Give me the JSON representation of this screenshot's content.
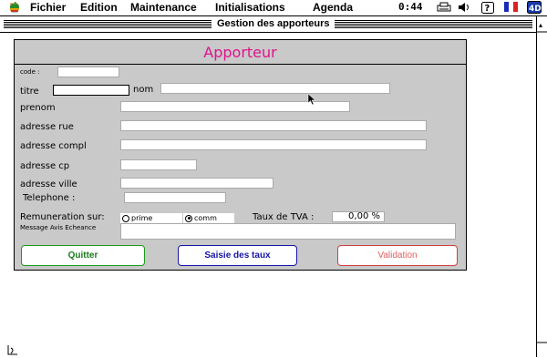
{
  "menubar": {
    "items": [
      "Fichier",
      "Edition",
      "Maintenance",
      "Initialisations",
      "Agenda"
    ],
    "clock": "0:44",
    "icons": [
      "apple-icon",
      "printer-icon",
      "sound-icon",
      "help-icon",
      "french-flag-icon",
      "4d-app-icon"
    ]
  },
  "window": {
    "title": "Gestion des apporteurs"
  },
  "form": {
    "header": "Apporteur",
    "labels": {
      "code": "code :",
      "titre": "titre",
      "nom": "nom",
      "prenom": "prenom",
      "adresse_rue": "adresse rue",
      "adresse_compl": "adresse compl",
      "adresse_cp": "adresse cp",
      "adresse_ville": "adresse ville",
      "telephone": "Telephone :",
      "remuneration": "Remuneration sur:",
      "taux_tva": "Taux de TVA :",
      "message": "Message Avis Echeance"
    },
    "values": {
      "code": "",
      "titre": "",
      "nom": "",
      "prenom": "",
      "adresse_rue": "",
      "adresse_compl": "",
      "adresse_cp": "",
      "adresse_ville": "",
      "telephone": "",
      "taux_tva": "0,00 %",
      "message": ""
    },
    "radio": {
      "options": [
        "prime",
        "comm"
      ],
      "selected": "comm"
    },
    "buttons": {
      "quitter": "Quitter",
      "saisie": "Saisie des taux",
      "validation": "Validation"
    },
    "colors": {
      "header_text": "#e0128e",
      "quitter_border": "#1a9a1a",
      "saisie_border": "#1515a8",
      "validation_border": "#d04040"
    }
  }
}
